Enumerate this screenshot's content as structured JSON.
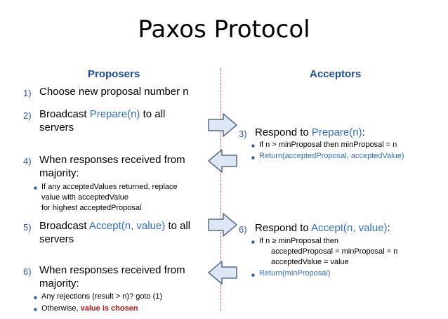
{
  "title": "Paxos Protocol",
  "proposers": {
    "heading": "Proposers",
    "step1": {
      "num": "1)",
      "text": "Choose new proposal number n"
    },
    "step2": {
      "num": "2)",
      "before": "Broadcast ",
      "highlight": "Prepare(n)",
      "after": " to all",
      "line2": "servers"
    },
    "step4": {
      "num": "4)",
      "line1": "When responses received from",
      "line2": "majority:",
      "bullet": "If any acceptedValues returned, replace",
      "bullet_l2": "value with acceptedValue",
      "bullet_l3": "for highest acceptedProposal"
    },
    "step5": {
      "num": "5)",
      "before": "Broadcast ",
      "highlight": "Accept(n, value)",
      "after": " to all",
      "line2": "servers"
    },
    "step6": {
      "num": "6)",
      "line1": "When responses received from",
      "line2": "majority:",
      "bullet1": "Any rejections (result > n)?  goto (1)",
      "bullet2_before": "Otherwise, ",
      "bullet2_red": "value is chosen"
    }
  },
  "acceptors": {
    "heading": "Acceptors",
    "step3": {
      "num": "3)",
      "before": "Respond to ",
      "highlight": "Prepare(n)",
      "after": ":",
      "bullet1": "If n > minProposal then minProposal = n",
      "bullet2": "Return(acceptedProposal, acceptedValue)"
    },
    "step6": {
      "num": "6)",
      "before": "Respond to ",
      "highlight": "Accept(n, value)",
      "after": ":",
      "bullet1": "If n ≥ minProposal then",
      "bullet1_l2": "acceptedProposal = minProposal = n",
      "bullet1_l3": "acceptedValue = value",
      "bullet2": "Return(minProposal)"
    }
  },
  "colors": {
    "heading": "#1f4e9c",
    "highlight": "#2f6bd0",
    "chosen": "#b01818",
    "arrow_fill": "#dce6f4",
    "arrow_stroke": "#5a6b86",
    "divider": "#d04040"
  }
}
